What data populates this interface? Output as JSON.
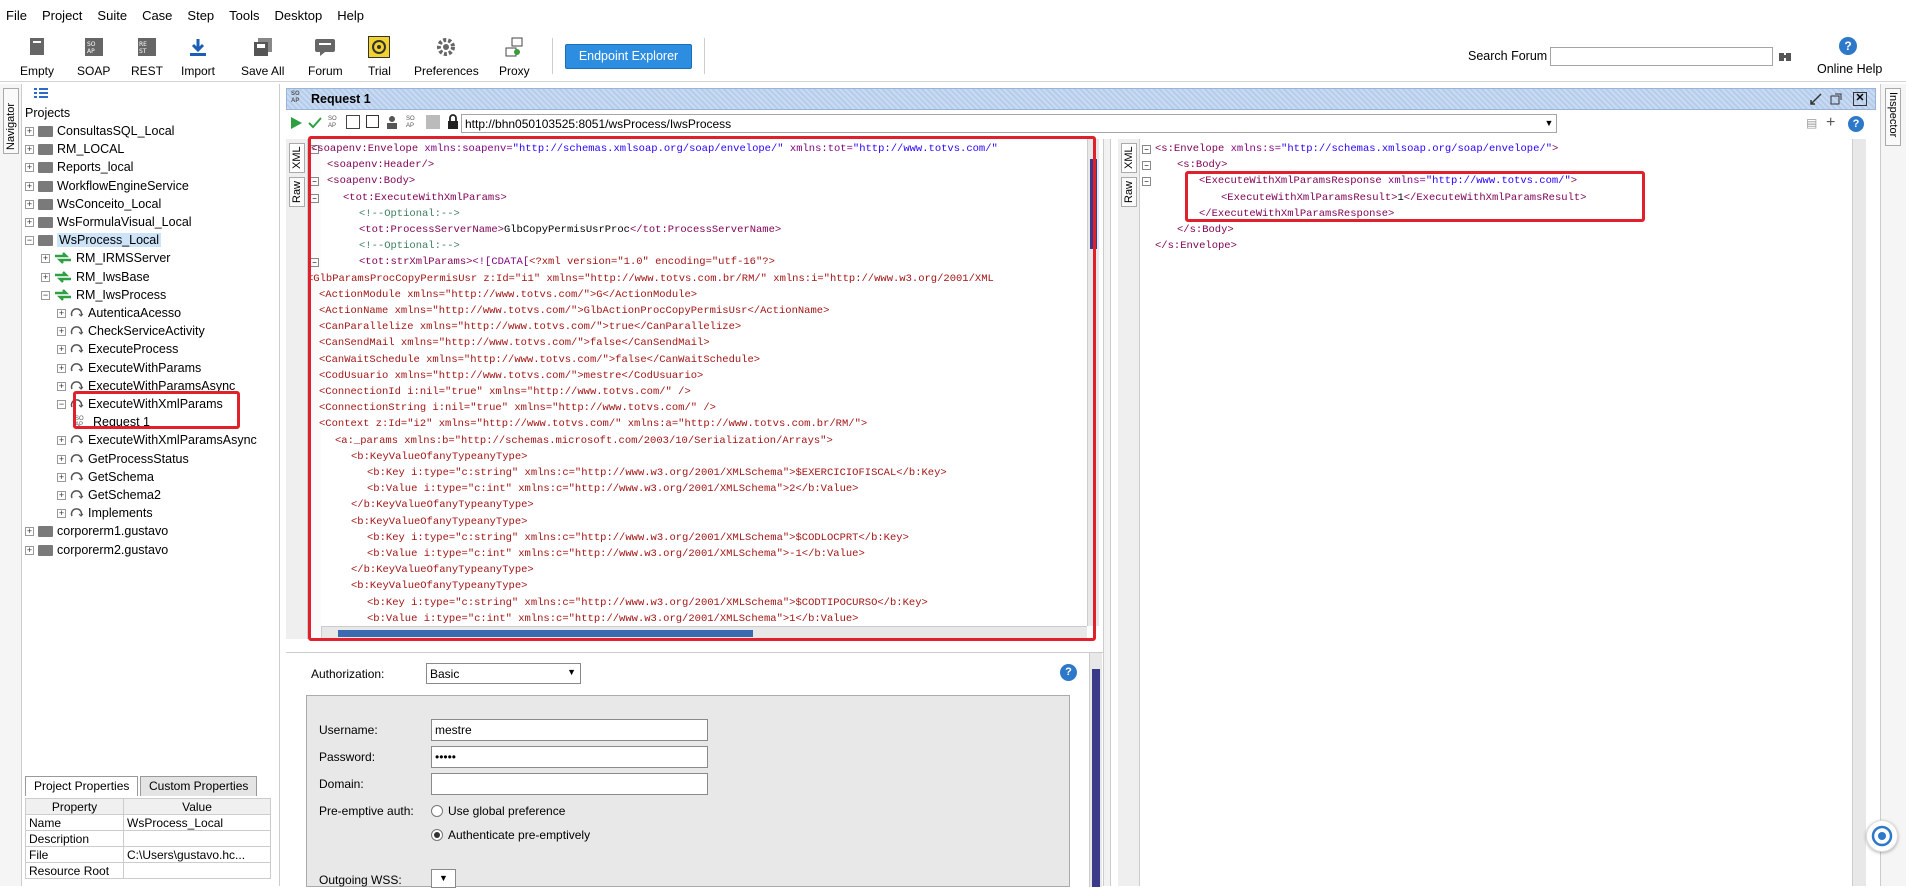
{
  "menu": [
    "File",
    "Project",
    "Suite",
    "Case",
    "Step",
    "Tools",
    "Desktop",
    "Help"
  ],
  "toolbar": {
    "empty": "Empty",
    "soap": "SOAP",
    "rest": "REST",
    "import": "Import",
    "save_all": "Save All",
    "forum": "Forum",
    "trial": "Trial",
    "preferences": "Preferences",
    "proxy": "Proxy",
    "endpoint_explorer": "Endpoint Explorer",
    "search_forum": "Search Forum",
    "online_help": "Online Help"
  },
  "side_tabs": {
    "navigator": "Navigator",
    "inspector": "Inspector"
  },
  "navigator": {
    "root": "Projects",
    "projects": [
      "ConsultasSQL_Local",
      "RM_LOCAL",
      "Reports_local",
      "WorkflowEngineService",
      "WsConceito_Local",
      "WsFormulaVisual_Local",
      "WsProcess_Local"
    ],
    "interfaces": [
      "RM_IRMSServer",
      "RM_IwsBase",
      "RM_IwsProcess"
    ],
    "operations": [
      "AutenticaAcesso",
      "CheckServiceActivity",
      "ExecuteProcess",
      "ExecuteWithParams",
      "ExecuteWithParamsAsync",
      "ExecuteWithXmlParams"
    ],
    "request": "Request 1",
    "operations2": [
      "ExecuteWithXmlParamsAsync",
      "GetProcessStatus",
      "GetSchema",
      "GetSchema2",
      "Implements"
    ],
    "projects2": [
      "corporerm1.gustavo",
      "corporerm2.gustavo"
    ]
  },
  "props": {
    "tab1": "Project Properties",
    "tab2": "Custom Properties",
    "col_property": "Property",
    "col_value": "Value",
    "rows": [
      [
        "Name",
        "WsProcess_Local"
      ],
      [
        "Description",
        ""
      ],
      [
        "File",
        "C:\\Users\\gustavo.hc..."
      ],
      [
        "Resource Root",
        ""
      ]
    ]
  },
  "editor": {
    "title": "Request 1",
    "endpoint": "http://bhn050103525:8051/wsProcess/IwsProcess",
    "xml_tab": "XML",
    "raw_tab": "Raw"
  },
  "request_lines": [
    [
      0,
      [
        [
          "t",
          "<soapenv:Envelope "
        ],
        [
          "a",
          "xmlns:soapenv="
        ],
        [
          "v",
          "\"http://schemas.xmlsoap.org/soap/envelope/\" "
        ],
        [
          "a",
          "xmlns:tot="
        ],
        [
          "v",
          "\"http://www.totvs.com/\""
        ]
      ]
    ],
    [
      1,
      [
        [
          "t",
          "<soapenv:Header/>"
        ]
      ]
    ],
    [
      1,
      [
        [
          "t",
          "<soapenv:Body>"
        ]
      ]
    ],
    [
      2,
      [
        [
          "t",
          "<tot:ExecuteWithXmlParams>"
        ]
      ]
    ],
    [
      3,
      [
        [
          "c",
          "<!--Optional:-->"
        ]
      ]
    ],
    [
      3,
      [
        [
          "t",
          "<tot:ProcessServerName>"
        ],
        [
          "k",
          "GlbCopyPermisUsrProc"
        ],
        [
          "t",
          "</tot:ProcessServerName>"
        ]
      ]
    ],
    [
      3,
      [
        [
          "c",
          "<!--Optional:-->"
        ]
      ]
    ],
    [
      3,
      [
        [
          "t",
          "<tot:strXmlParams>"
        ],
        [
          "a",
          "<![CDATA["
        ],
        [
          "cd",
          "<?xml version=\"1.0\" encoding=\"utf-16\"?>"
        ]
      ]
    ],
    [
      -1,
      [
        [
          "cd",
          "<GlbParamsProcCopyPermisUsr z:Id=\"i1\" xmlns=\"http://www.totvs.com.br/RM/\" xmlns:i=\"http://www.w3.org/2001/XML"
        ]
      ]
    ],
    [
      0.5,
      [
        [
          "cd",
          "<ActionModule xmlns=\"http://www.totvs.com/\">G</ActionModule>"
        ]
      ]
    ],
    [
      0.5,
      [
        [
          "cd",
          "<ActionName xmlns=\"http://www.totvs.com/\">GlbActionProcCopyPermisUsr</ActionName>"
        ]
      ]
    ],
    [
      0.5,
      [
        [
          "cd",
          "<CanParallelize xmlns=\"http://www.totvs.com/\">true</CanParallelize>"
        ]
      ]
    ],
    [
      0.5,
      [
        [
          "cd",
          "<CanSendMail xmlns=\"http://www.totvs.com/\">false</CanSendMail>"
        ]
      ]
    ],
    [
      0.5,
      [
        [
          "cd",
          "<CanWaitSchedule xmlns=\"http://www.totvs.com/\">false</CanWaitSchedule>"
        ]
      ]
    ],
    [
      0.5,
      [
        [
          "cd",
          "<CodUsuario xmlns=\"http://www.totvs.com/\">mestre</CodUsuario>"
        ]
      ]
    ],
    [
      0.5,
      [
        [
          "cd",
          "<ConnectionId i:nil=\"true\" xmlns=\"http://www.totvs.com/\" />"
        ]
      ]
    ],
    [
      0.5,
      [
        [
          "cd",
          "<ConnectionString i:nil=\"true\" xmlns=\"http://www.totvs.com/\" />"
        ]
      ]
    ],
    [
      0.5,
      [
        [
          "cd",
          "<Context z:Id=\"i2\" xmlns=\"http://www.totvs.com/\" xmlns:a=\"http://www.totvs.com.br/RM/\">"
        ]
      ]
    ],
    [
      1.5,
      [
        [
          "cd",
          "<a:_params xmlns:b=\"http://schemas.microsoft.com/2003/10/Serialization/Arrays\">"
        ]
      ]
    ],
    [
      2.5,
      [
        [
          "cd",
          "<b:KeyValueOfanyTypeanyType>"
        ]
      ]
    ],
    [
      3.5,
      [
        [
          "cd",
          "<b:Key i:type=\"c:string\" xmlns:c=\"http://www.w3.org/2001/XMLSchema\">$EXERCICIOFISCAL</b:Key>"
        ]
      ]
    ],
    [
      3.5,
      [
        [
          "cd",
          "<b:Value i:type=\"c:int\" xmlns:c=\"http://www.w3.org/2001/XMLSchema\">2</b:Value>"
        ]
      ]
    ],
    [
      2.5,
      [
        [
          "cd",
          "</b:KeyValueOfanyTypeanyType>"
        ]
      ]
    ],
    [
      2.5,
      [
        [
          "cd",
          "<b:KeyValueOfanyTypeanyType>"
        ]
      ]
    ],
    [
      3.5,
      [
        [
          "cd",
          "<b:Key i:type=\"c:string\" xmlns:c=\"http://www.w3.org/2001/XMLSchema\">$CODLOCPRT</b:Key>"
        ]
      ]
    ],
    [
      3.5,
      [
        [
          "cd",
          "<b:Value i:type=\"c:int\" xmlns:c=\"http://www.w3.org/2001/XMLSchema\">-1</b:Value>"
        ]
      ]
    ],
    [
      2.5,
      [
        [
          "cd",
          "</b:KeyValueOfanyTypeanyType>"
        ]
      ]
    ],
    [
      2.5,
      [
        [
          "cd",
          "<b:KeyValueOfanyTypeanyType>"
        ]
      ]
    ],
    [
      3.5,
      [
        [
          "cd",
          "<b:Key i:type=\"c:string\" xmlns:c=\"http://www.w3.org/2001/XMLSchema\">$CODTIPOCURSO</b:Key>"
        ]
      ]
    ],
    [
      3.5,
      [
        [
          "cd",
          "<b:Value i:type=\"c:int\" xmlns:c=\"http://www.w3.org/2001/XMLSchema\">1</b:Value>"
        ]
      ]
    ]
  ],
  "response_lines": [
    [
      0,
      [
        [
          "t",
          "<s:Envelope "
        ],
        [
          "a",
          "xmlns:s="
        ],
        [
          "v",
          "\"http://schemas.xmlsoap.org/soap/envelope/\""
        ],
        [
          "t",
          ">"
        ]
      ]
    ],
    [
      1,
      [
        [
          "t",
          "<s:Body>"
        ]
      ]
    ],
    [
      2,
      [
        [
          "t",
          "<ExecuteWithXmlParamsResponse "
        ],
        [
          "a",
          "xmlns="
        ],
        [
          "v",
          "\"http://www.totvs.com/\""
        ],
        [
          "t",
          ">"
        ]
      ]
    ],
    [
      3,
      [
        [
          "t",
          "<ExecuteWithXmlParamsResult>"
        ],
        [
          "k",
          "1"
        ],
        [
          "t",
          "</ExecuteWithXmlParamsResult>"
        ]
      ]
    ],
    [
      2,
      [
        [
          "t",
          "</ExecuteWithXmlParamsResponse>"
        ]
      ]
    ],
    [
      1,
      [
        [
          "t",
          "</s:Body>"
        ]
      ]
    ],
    [
      0,
      [
        [
          "t",
          "</s:Envelope>"
        ]
      ]
    ]
  ],
  "auth": {
    "authorization_label": "Authorization:",
    "authorization_value": "Basic",
    "username_label": "Username:",
    "username_value": "mestre",
    "password_label": "Password:",
    "password_value": "•••••",
    "domain_label": "Domain:",
    "domain_value": "",
    "preemptive_label": "Pre-emptive auth:",
    "opt_global": "Use global preference",
    "opt_preemptive": "Authenticate pre-emptively",
    "wss_label": "Outgoing WSS:"
  },
  "colors": {
    "highlight": "#e0202a",
    "accent": "#2d8de0",
    "selection": "#cde3f7"
  }
}
